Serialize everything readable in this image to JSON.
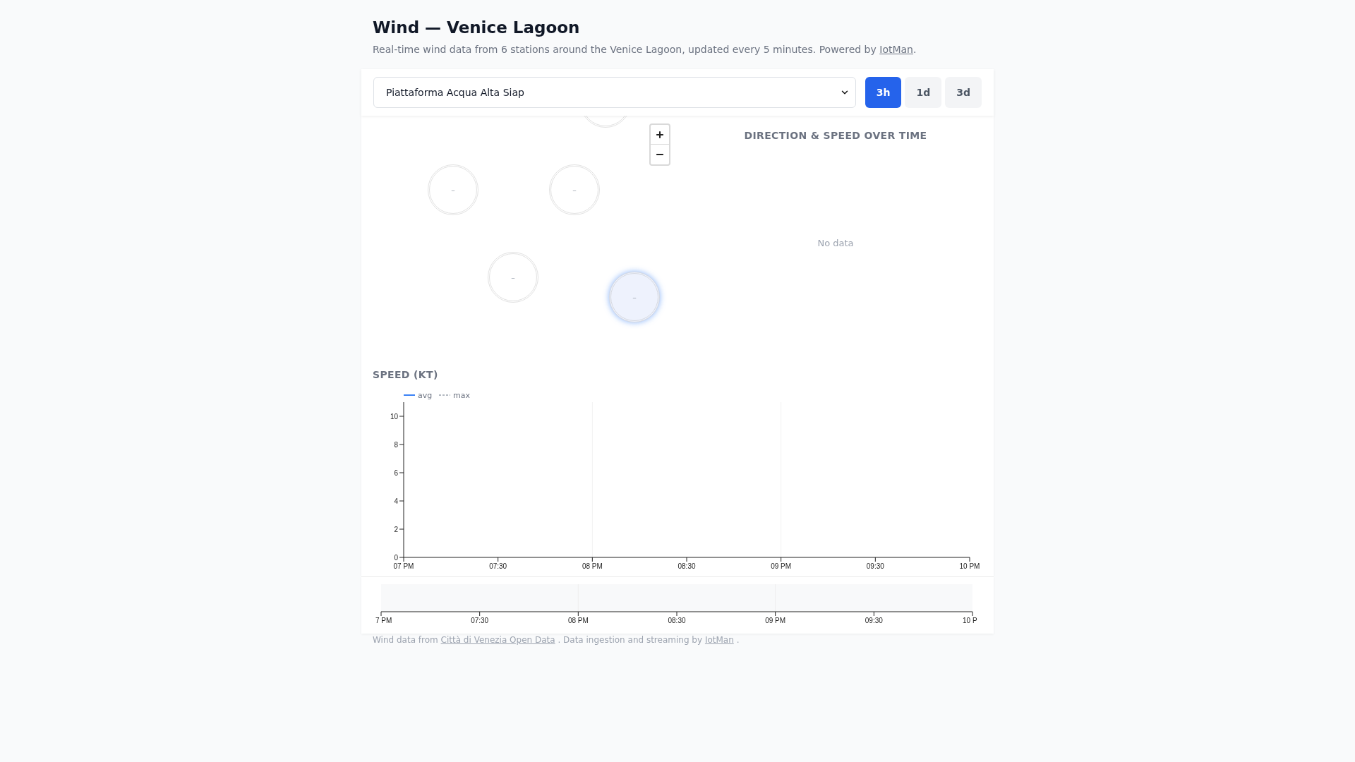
{
  "header": {
    "title": "Wind — Venice Lagoon",
    "subtitle": "Real-time wind data from 6 stations around the Venice Lagoon, updated every 5 minutes. Powered by",
    "subtitle_link": "IotMan",
    "subtitle_end": "."
  },
  "controls": {
    "station": "Piattaforma Acqua Alta Siap",
    "ranges": [
      {
        "label": "3h",
        "selected": true
      },
      {
        "label": "1d",
        "selected": false
      },
      {
        "label": "3d",
        "selected": false
      }
    ]
  },
  "map": {
    "markers": [
      {
        "selected": false
      },
      {
        "label": "–",
        "selected": false
      },
      {
        "label": "–",
        "selected": false
      },
      {
        "label": "–",
        "selected": false
      },
      {
        "label": "–",
        "selected": true
      }
    ]
  },
  "direction_panel": {
    "title": "DIRECTION & SPEED OVER TIME",
    "message": "No data"
  },
  "speed_panel": {
    "title": "SPEED (KT)",
    "chart_data": [
      {
        "type": "line",
        "series": [
          {
            "name": "avg",
            "color": "#3b82f6",
            "line_style": "solid",
            "values": [
              null,
              null,
              null,
              null,
              null,
              null,
              null
            ]
          },
          {
            "name": "max",
            "color": "#9ca3af",
            "line_style": "dashed",
            "values": [
              null,
              null,
              null,
              null,
              null,
              null,
              null
            ]
          }
        ],
        "categories": [
          "07 PM",
          "07:30",
          "08 PM",
          "08:30",
          "09 PM",
          "09:30",
          "10 PM"
        ],
        "ylim": [
          0,
          11
        ],
        "yticks": [
          0,
          2,
          4,
          6,
          8,
          10
        ]
      }
    ]
  },
  "time_brush": {
    "time_labels": [
      "7 PM",
      "07:30",
      "08 PM",
      "08:30",
      "09 PM",
      "09:30",
      "10 P"
    ]
  },
  "footer": {
    "text_1": "Wind data from",
    "link_1": "Città di Venezia Open Data",
    "text_2": ". Data ingestion and streaming by",
    "link_2": "IotMan",
    "text_3": "."
  }
}
